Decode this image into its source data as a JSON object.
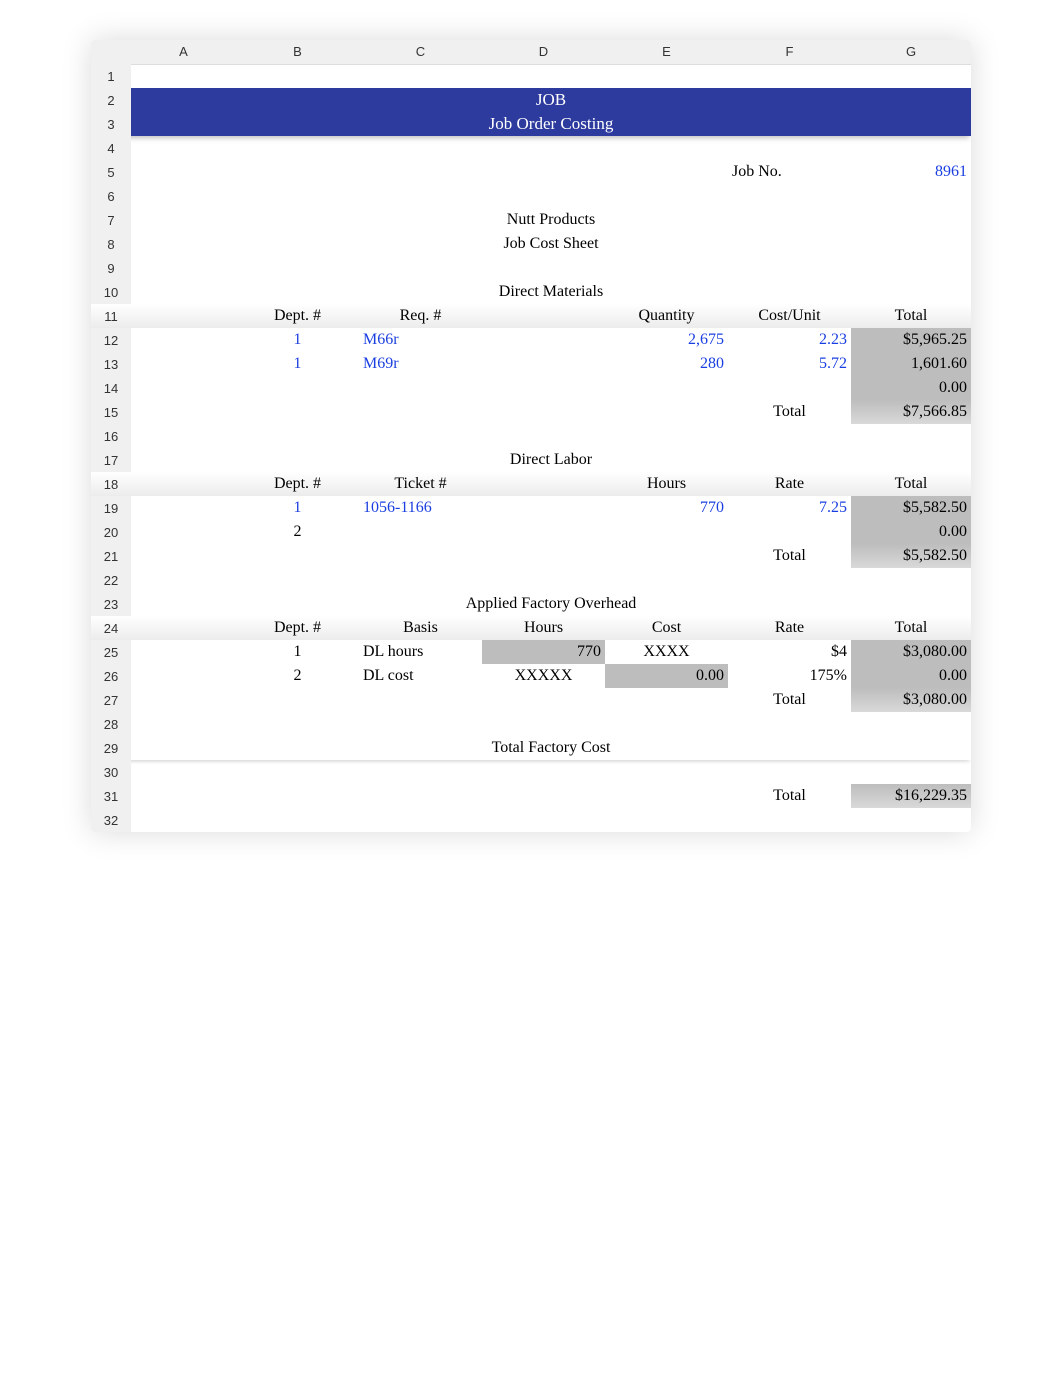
{
  "columns": [
    "A",
    "B",
    "C",
    "D",
    "E",
    "F",
    "G"
  ],
  "rows": [
    "1",
    "2",
    "3",
    "4",
    "5",
    "6",
    "7",
    "8",
    "9",
    "10",
    "11",
    "12",
    "13",
    "14",
    "15",
    "16",
    "17",
    "18",
    "19",
    "20",
    "21",
    "22",
    "23",
    "24",
    "25",
    "26",
    "27",
    "28",
    "29",
    "30",
    "31",
    "32"
  ],
  "banner": {
    "line1": "JOB",
    "line2": "Job Order Costing"
  },
  "jobno_label": "Job No.",
  "jobno_value": "8961",
  "company": "Nutt Products",
  "sheet_title": "Job Cost Sheet",
  "direct_materials": {
    "heading": "Direct Materials",
    "headers": {
      "dept": "Dept. #",
      "req": "Req. #",
      "qty": "Quantity",
      "costunit": "Cost/Unit",
      "total": "Total"
    },
    "rows": [
      {
        "dept": "1",
        "req": "M66r",
        "qty": "2,675",
        "costunit": "2.23",
        "total": "$5,965.25"
      },
      {
        "dept": "1",
        "req": "M69r",
        "qty": "280",
        "costunit": "5.72",
        "total": "1,601.60"
      },
      {
        "dept": "",
        "req": "",
        "qty": "",
        "costunit": "",
        "total": "0.00"
      }
    ],
    "total_label": "Total",
    "total_value": "$7,566.85"
  },
  "direct_labor": {
    "heading": "Direct Labor",
    "headers": {
      "dept": "Dept. #",
      "ticket": "Ticket #",
      "hours": "Hours",
      "rate": "Rate",
      "total": "Total"
    },
    "rows": [
      {
        "dept": "1",
        "ticket": "1056-1166",
        "hours": "770",
        "rate": "7.25",
        "total": "$5,582.50"
      },
      {
        "dept": "2",
        "ticket": "",
        "hours": "",
        "rate": "",
        "total": "0.00"
      }
    ],
    "total_label": "Total",
    "total_value": "$5,582.50"
  },
  "overhead": {
    "heading": "Applied Factory Overhead",
    "headers": {
      "dept": "Dept. #",
      "basis": "Basis",
      "hours": "Hours",
      "cost": "Cost",
      "rate": "Rate",
      "total": "Total"
    },
    "rows": [
      {
        "dept": "1",
        "basis": "DL hours",
        "hours": "770",
        "cost": "XXXX",
        "rate": "$4",
        "total": "$3,080.00"
      },
      {
        "dept": "2",
        "basis": "DL cost",
        "hours": "XXXXX",
        "cost": "0.00",
        "rate": "175%",
        "total": "0.00"
      }
    ],
    "total_label": "Total",
    "total_value": "$3,080.00"
  },
  "grand_total": {
    "heading": "Total Factory Cost",
    "label": "Total",
    "value": "$16,229.35"
  }
}
